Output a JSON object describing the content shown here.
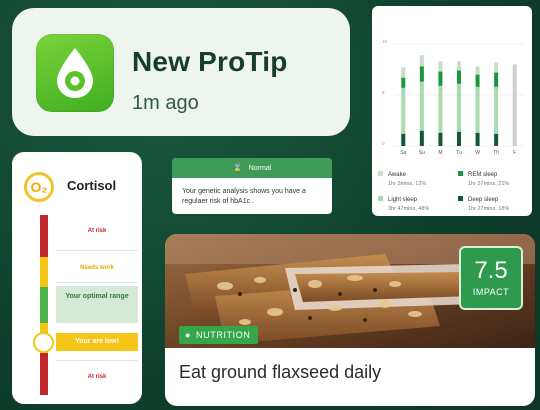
{
  "protip": {
    "title": "New ProTip",
    "time": "1m ago",
    "icon": "water-drop-icon",
    "accent": "#4bbd28"
  },
  "sleep": {
    "y_ticks": [
      "10",
      "5",
      "0"
    ],
    "legend": [
      {
        "label": "Awake",
        "detail": "1hr 3mins, 13%",
        "color": "#c8ddc8"
      },
      {
        "label": "REM sleep",
        "detail": "1hr 37mins, 21%",
        "color": "#179a3d"
      },
      {
        "label": "Light sleep",
        "detail": "3hr 47mins, 48%",
        "color": "#a9dbae"
      },
      {
        "label": "Deep sleep",
        "detail": "1hr 27mins, 18%",
        "color": "#13573a"
      }
    ],
    "chart_data": {
      "type": "bar",
      "categories": [
        "Sa",
        "Su",
        "M",
        "Tu",
        "W",
        "Th",
        "F"
      ],
      "ylim": [
        0,
        10
      ],
      "series": [
        {
          "name": "Deep sleep",
          "values": [
            1.2,
            1.5,
            1.3,
            1.4,
            1.3,
            1.2,
            0
          ]
        },
        {
          "name": "Light sleep",
          "values": [
            4.5,
            4.8,
            4.6,
            4.7,
            4.5,
            4.6,
            0
          ]
        },
        {
          "name": "REM sleep",
          "values": [
            1.0,
            1.5,
            1.4,
            1.3,
            1.2,
            1.4,
            0
          ]
        },
        {
          "name": "Awake",
          "values": [
            1.0,
            1.1,
            1.0,
            0.9,
            0.8,
            1.0,
            8.0
          ]
        }
      ]
    }
  },
  "normal_card": {
    "status": "Normal",
    "icon": "hourglass-icon",
    "text": "Your genetic analysis shows you have a regulaer risk of hbA1c ."
  },
  "cortisol": {
    "badge": "O₂",
    "title": "Cortisol",
    "zones": {
      "top_risk": "At risk",
      "needs_work": "Needs work",
      "optimal": "Your optimal range",
      "current": "Your are low!",
      "bottom_risk": "At risk"
    },
    "colors": {
      "risk": "#c0262d",
      "warn": "#f5c518",
      "good": "#49b34a"
    }
  },
  "nutrition": {
    "impact_value": "7.5",
    "impact_label": "IMPACT",
    "category": "NUTRITION",
    "category_icon": "apple-icon",
    "title": "Eat ground flaxseed daily"
  }
}
